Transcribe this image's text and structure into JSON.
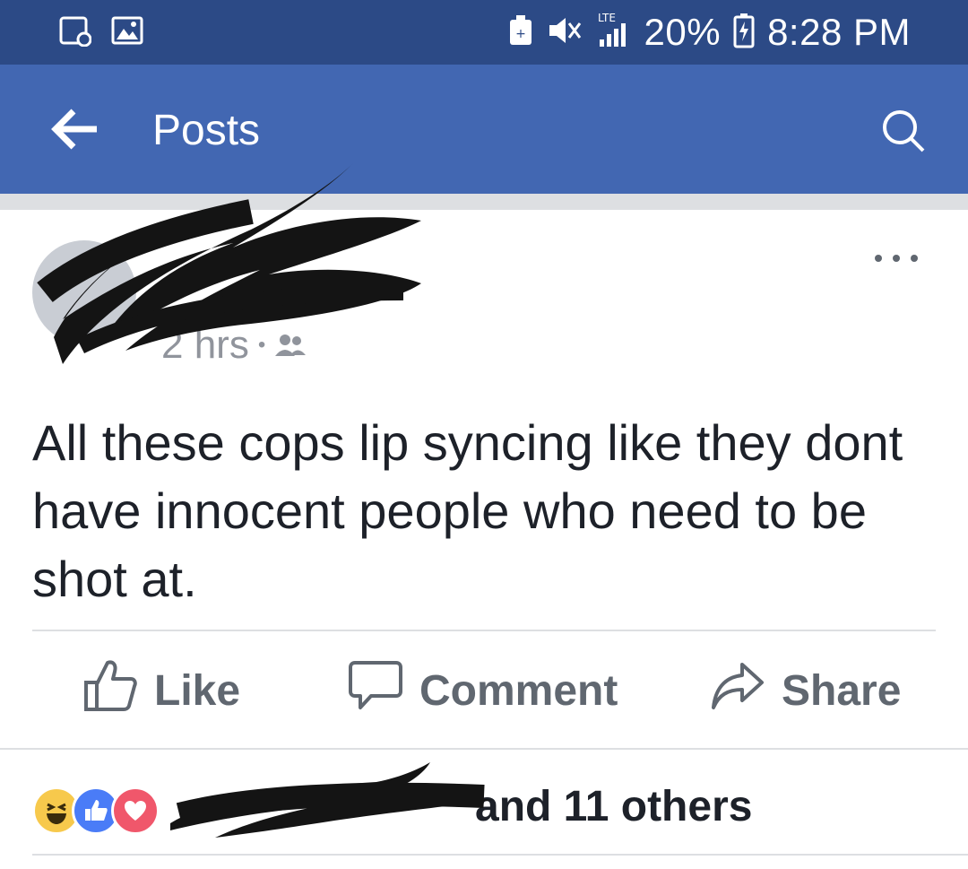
{
  "status_bar": {
    "battery": "20%",
    "time": "8:28 PM",
    "network_label": "LTE",
    "icons": [
      "screenshot-icon",
      "gallery-icon",
      "battery-saver-icon",
      "mute-icon",
      "signal-icon",
      "battery-icon"
    ]
  },
  "app_bar": {
    "title": "Posts",
    "back_icon": "back-arrow-icon",
    "search_icon": "search-icon"
  },
  "post": {
    "author_name": "",
    "timestamp": "2 hrs",
    "separator": "•",
    "privacy_icon": "friends-icon",
    "more_icon": "more-options-icon",
    "text": "All these cops lip syncing like they dont have innocent people who need to be shot at."
  },
  "actions": {
    "like": "Like",
    "comment": "Comment",
    "share": "Share"
  },
  "reactions": {
    "icons": [
      "haha-reaction-icon",
      "like-reaction-icon",
      "love-reaction-icon"
    ],
    "summary_suffix": "and 11 others"
  },
  "colors": {
    "status_bar": "#2c4a86",
    "app_bar": "#4267b2",
    "text": "#1d2129",
    "muted": "#606770",
    "divider": "#dddfe2"
  }
}
